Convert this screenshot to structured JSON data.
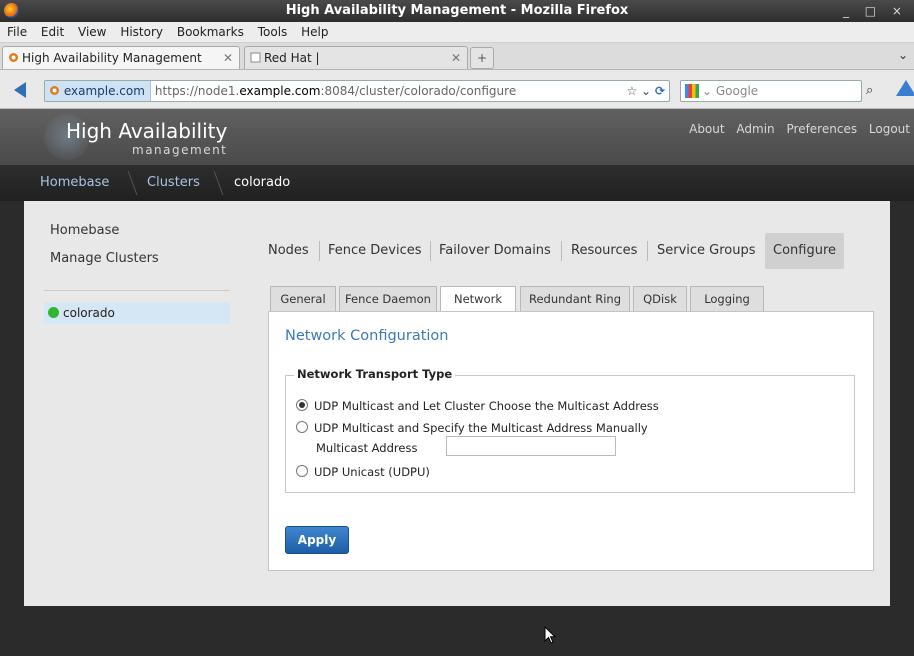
{
  "window": {
    "title": "High Availability Management - Mozilla Firefox",
    "controls": "_ □ ×"
  },
  "menubar": [
    "File",
    "Edit",
    "View",
    "History",
    "Bookmarks",
    "Tools",
    "Help"
  ],
  "tabs": [
    {
      "label": "High Availability Management",
      "close": "✕"
    },
    {
      "label": "Red Hat |",
      "close": "✕"
    }
  ],
  "newtab": "+",
  "tab_scroll": "⌄",
  "nav": {
    "identity": "example.com",
    "url_prefix": "https://node1.",
    "url_host": "example.com",
    "url_suffix": ":8084/cluster/colorado/configure",
    "search_placeholder": "Google"
  },
  "header": {
    "title": "High Availability",
    "subtitle": "management",
    "links": [
      "About",
      "Admin",
      "Preferences",
      "Logout"
    ]
  },
  "breadcrumb": [
    "Homebase",
    "Clusters",
    "colorado"
  ],
  "sidebar": {
    "links": [
      "Homebase",
      "Manage Clusters"
    ],
    "clusters": [
      {
        "name": "colorado",
        "status_color": "#2fb82f"
      }
    ]
  },
  "main_tabs": [
    "Nodes",
    "Fence Devices",
    "Failover Domains",
    "Resources",
    "Service Groups",
    "Configure"
  ],
  "active_main_tab": "Configure",
  "sub_tabs": [
    "General",
    "Fence Daemon",
    "Network",
    "Redundant Ring",
    "QDisk",
    "Logging"
  ],
  "active_sub_tab": "Network",
  "panel": {
    "title": "Network Configuration",
    "legend": "Network Transport Type",
    "options": [
      {
        "label": "UDP Multicast and Let Cluster Choose the Multicast Address",
        "checked": true
      },
      {
        "label": "UDP Multicast and Specify the Multicast Address Manually",
        "checked": false
      },
      {
        "label": "UDP Unicast (UDPU)",
        "checked": false
      }
    ],
    "multicast_label": "Multicast Address",
    "multicast_value": "",
    "apply_label": "Apply"
  },
  "colors": {
    "accent": "#3c7ab5",
    "button": "#2a6fba",
    "status_ok": "#2fb82f"
  }
}
